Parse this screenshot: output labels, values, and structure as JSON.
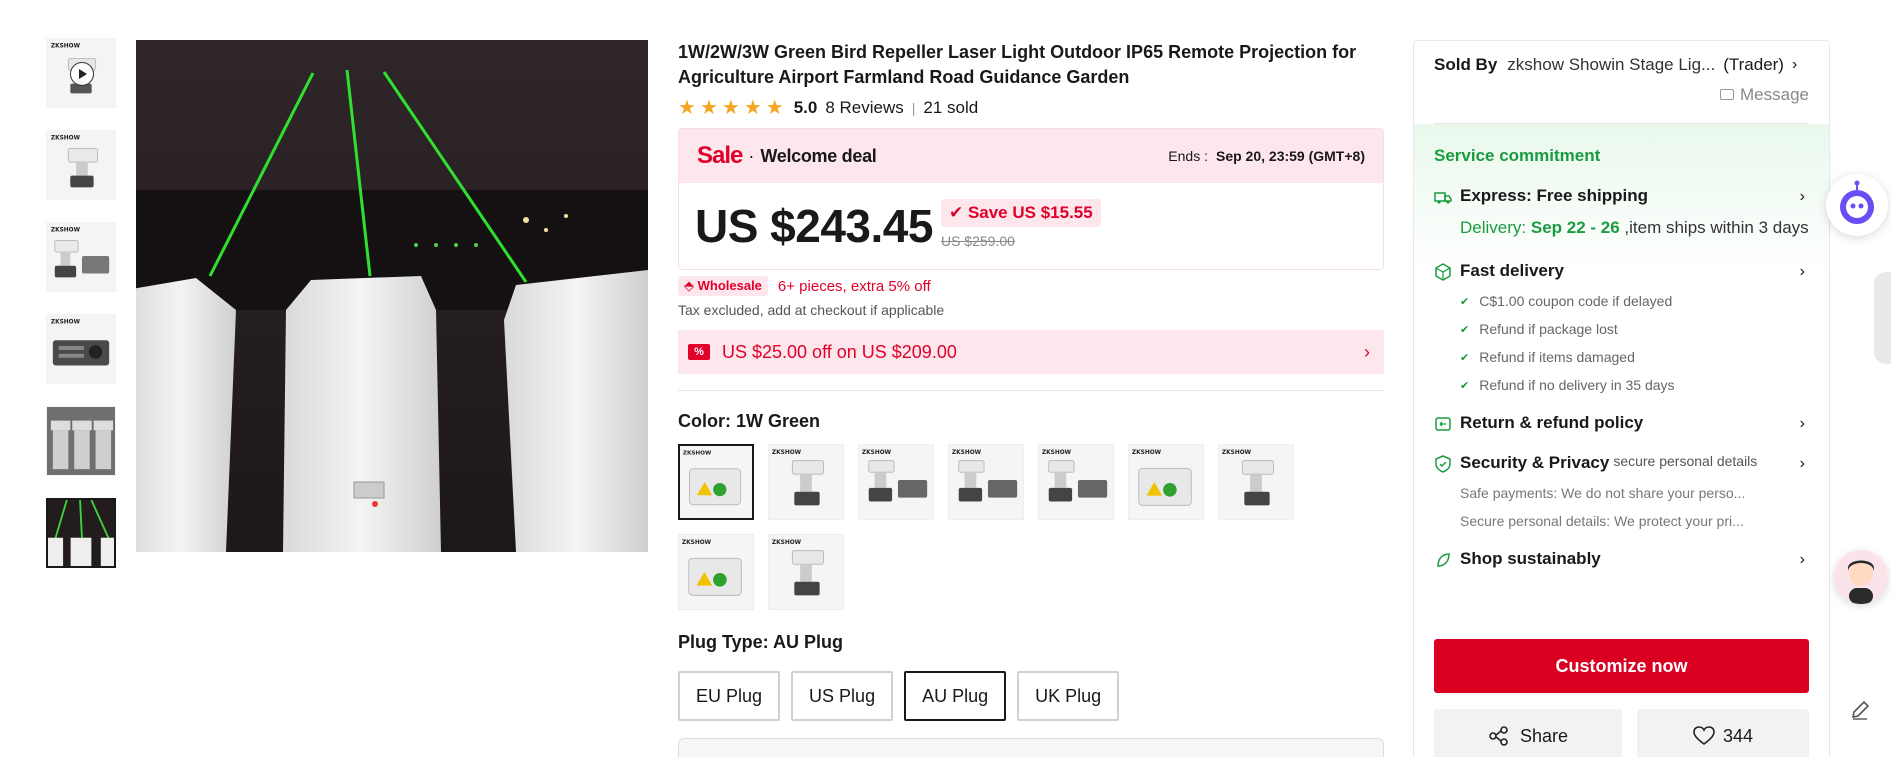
{
  "gallery": {
    "thumbnails": [
      {
        "name": "thumb-video",
        "has_play": true
      },
      {
        "name": "thumb-2"
      },
      {
        "name": "thumb-3"
      },
      {
        "name": "thumb-4"
      },
      {
        "name": "thumb-5"
      },
      {
        "name": "thumb-6-active"
      }
    ]
  },
  "product": {
    "title": "1W/2W/3W Green Bird Repeller  Laser Light Outdoor IP65 Remote Projection for Agriculture Airport Farmland Road Guidance Garden",
    "rating_score": "5.0",
    "reviews": "8 Reviews",
    "sold": "21 sold",
    "stars": 5
  },
  "sale": {
    "sale_word": "Sale",
    "dot": "·",
    "deal": "Welcome deal",
    "ends_label": "Ends :",
    "ends_value": "Sep 20, 23:59 (GMT+8)",
    "price": "US $243.45",
    "save": "Save US $15.55",
    "original": "US $259.00"
  },
  "wholesale": {
    "tag": "Wholesale",
    "text": "6+ pieces, extra 5% off"
  },
  "tax_note": "Tax excluded, add at checkout if applicable",
  "coupon": {
    "text": "US $25.00 off on US $209.00",
    "icon": "%"
  },
  "color": {
    "label": "Color: ",
    "value": "1W Green",
    "selected_index": 0,
    "option_count": 9
  },
  "plug": {
    "label": "Plug Type: ",
    "value": "AU Plug",
    "options": [
      "EU Plug",
      "US Plug",
      "AU Plug",
      "UK Plug"
    ],
    "selected_index": 2
  },
  "seller": {
    "label": "Sold By",
    "store": "zkshow Showin Stage Lig...",
    "type": "(Trader)",
    "message": "Message"
  },
  "service": {
    "title": "Service commitment",
    "express_title": "Express: Free shipping",
    "delivery_label": "Delivery: ",
    "delivery_dates": "Sep 22 - 26",
    "delivery_rest": " ,item ships within 3 days",
    "fast_title": "Fast delivery",
    "fast_items": [
      "C$1.00 coupon code if delayed",
      "Refund if package lost",
      "Refund if items damaged",
      "Refund if no delivery in 35 days"
    ],
    "return_title": "Return & refund policy",
    "security_title": "Security & Privacy",
    "security_sub": "secure personal details",
    "security_lines": [
      "Safe payments: We do not share your perso...",
      "Secure personal details: We protect your pri..."
    ],
    "sustain_title": "Shop sustainably"
  },
  "actions": {
    "customize": "Customize now",
    "share": "Share",
    "wishlist_count": "344"
  },
  "colors": {
    "accent_red": "#d90022",
    "sale_red": "#e0002a",
    "green": "#1a9b3f",
    "sale_bg": "#fde7ec",
    "star": "#f5a623"
  }
}
